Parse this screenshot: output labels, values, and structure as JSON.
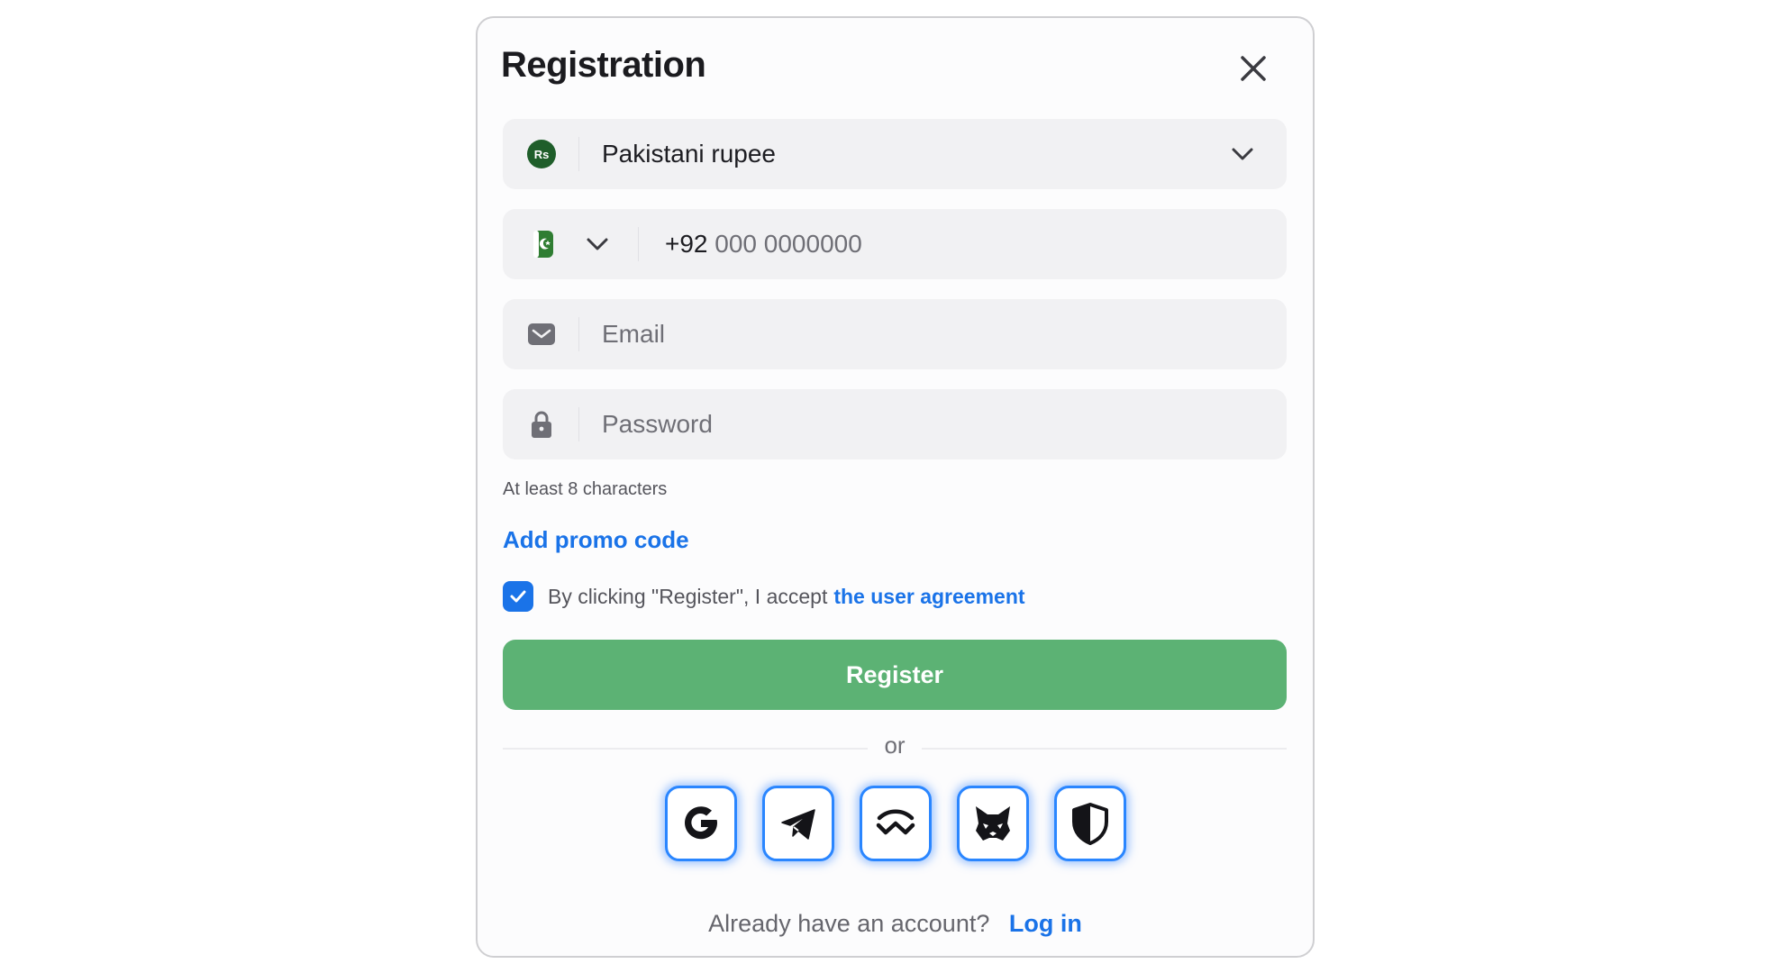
{
  "modal": {
    "title": "Registration",
    "currency": {
      "badge_text": "Rs",
      "value": "Pakistani rupee",
      "icon": "currency-badge-icon"
    },
    "phone": {
      "flag_icon": "pakistan-flag-icon",
      "prefix": "+92",
      "placeholder": "000 0000000"
    },
    "email": {
      "icon": "envelope-icon",
      "placeholder": "Email"
    },
    "password": {
      "icon": "lock-icon",
      "placeholder": "Password",
      "hint": "At least 8 characters"
    },
    "promo_link": "Add promo code",
    "agreement": {
      "checked": true,
      "text": "By clicking \"Register\", I accept",
      "link": "the user agreement"
    },
    "register_label": "Register",
    "divider_text": "or",
    "socials": [
      {
        "name": "google",
        "icon": "google-icon"
      },
      {
        "name": "telegram",
        "icon": "telegram-icon"
      },
      {
        "name": "walletconnect",
        "icon": "walletconnect-icon"
      },
      {
        "name": "metamask",
        "icon": "metamask-fox-icon"
      },
      {
        "name": "shield",
        "icon": "shield-icon"
      }
    ],
    "login": {
      "question": "Already have an account?",
      "link": "Log in"
    }
  },
  "colors": {
    "accent": "#1a73e8",
    "register_green": "#5cb274",
    "field_bg": "#f1f1f3"
  }
}
